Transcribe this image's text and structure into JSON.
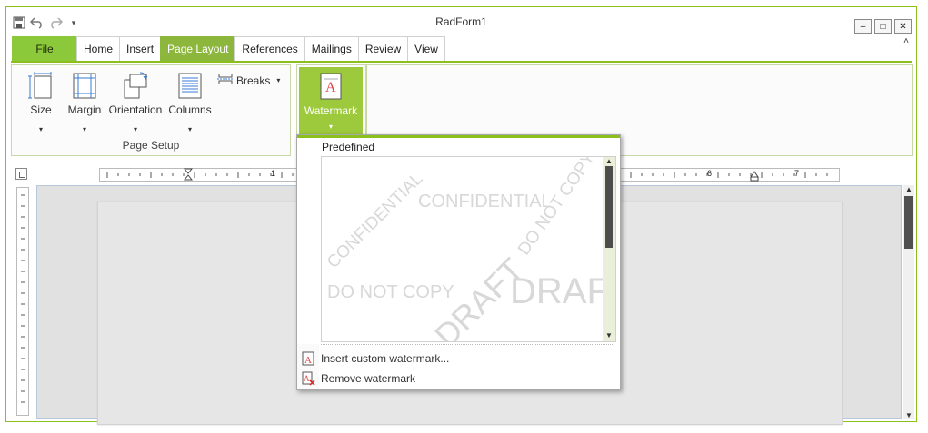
{
  "window": {
    "title": "RadForm1",
    "controls": [
      "–",
      "□",
      "✕"
    ],
    "collapse": "˄"
  },
  "qat": {
    "customize_arrow": "▾"
  },
  "tabs": [
    {
      "label": "File"
    },
    {
      "label": "Home"
    },
    {
      "label": "Insert"
    },
    {
      "label": "Page Layout"
    },
    {
      "label": "References"
    },
    {
      "label": "Mailings"
    },
    {
      "label": "Review"
    },
    {
      "label": "View"
    }
  ],
  "ribbon": {
    "page_setup": {
      "group_label": "Page Setup",
      "size_label": "Size",
      "margin_label": "Margin",
      "orientation_label": "Orientation",
      "columns_label": "Columns",
      "breaks_label": "Breaks",
      "arrow": "▾"
    },
    "watermark": {
      "label": "Watermark",
      "arrow": "▾"
    }
  },
  "ruler": {
    "marks": [
      "1",
      "6",
      "7"
    ]
  },
  "watermark_menu": {
    "header": "Predefined",
    "gallery": [
      {
        "text": "CONFIDENTIAL",
        "style": "diagonal"
      },
      {
        "text": "CONFIDENTIAL",
        "style": "horizontal"
      },
      {
        "text": "DO NOT COPY",
        "style": "diagonal"
      },
      {
        "text": "DO NOT COPY",
        "style": "horizontal"
      },
      {
        "text": "DRAFT",
        "style": "diagonal"
      },
      {
        "text": "DRAFT",
        "style": "horizontal"
      }
    ],
    "items": [
      {
        "label": "Insert custom watermark...",
        "icon": "insert-watermark-icon"
      },
      {
        "label": "Remove watermark",
        "icon": "remove-watermark-icon"
      }
    ]
  },
  "colors": {
    "accent": "#8bbf1e",
    "file_tab": "#8bc83a",
    "active_tab": "#8db63c",
    "watermark_text": "#d8d8d8"
  }
}
